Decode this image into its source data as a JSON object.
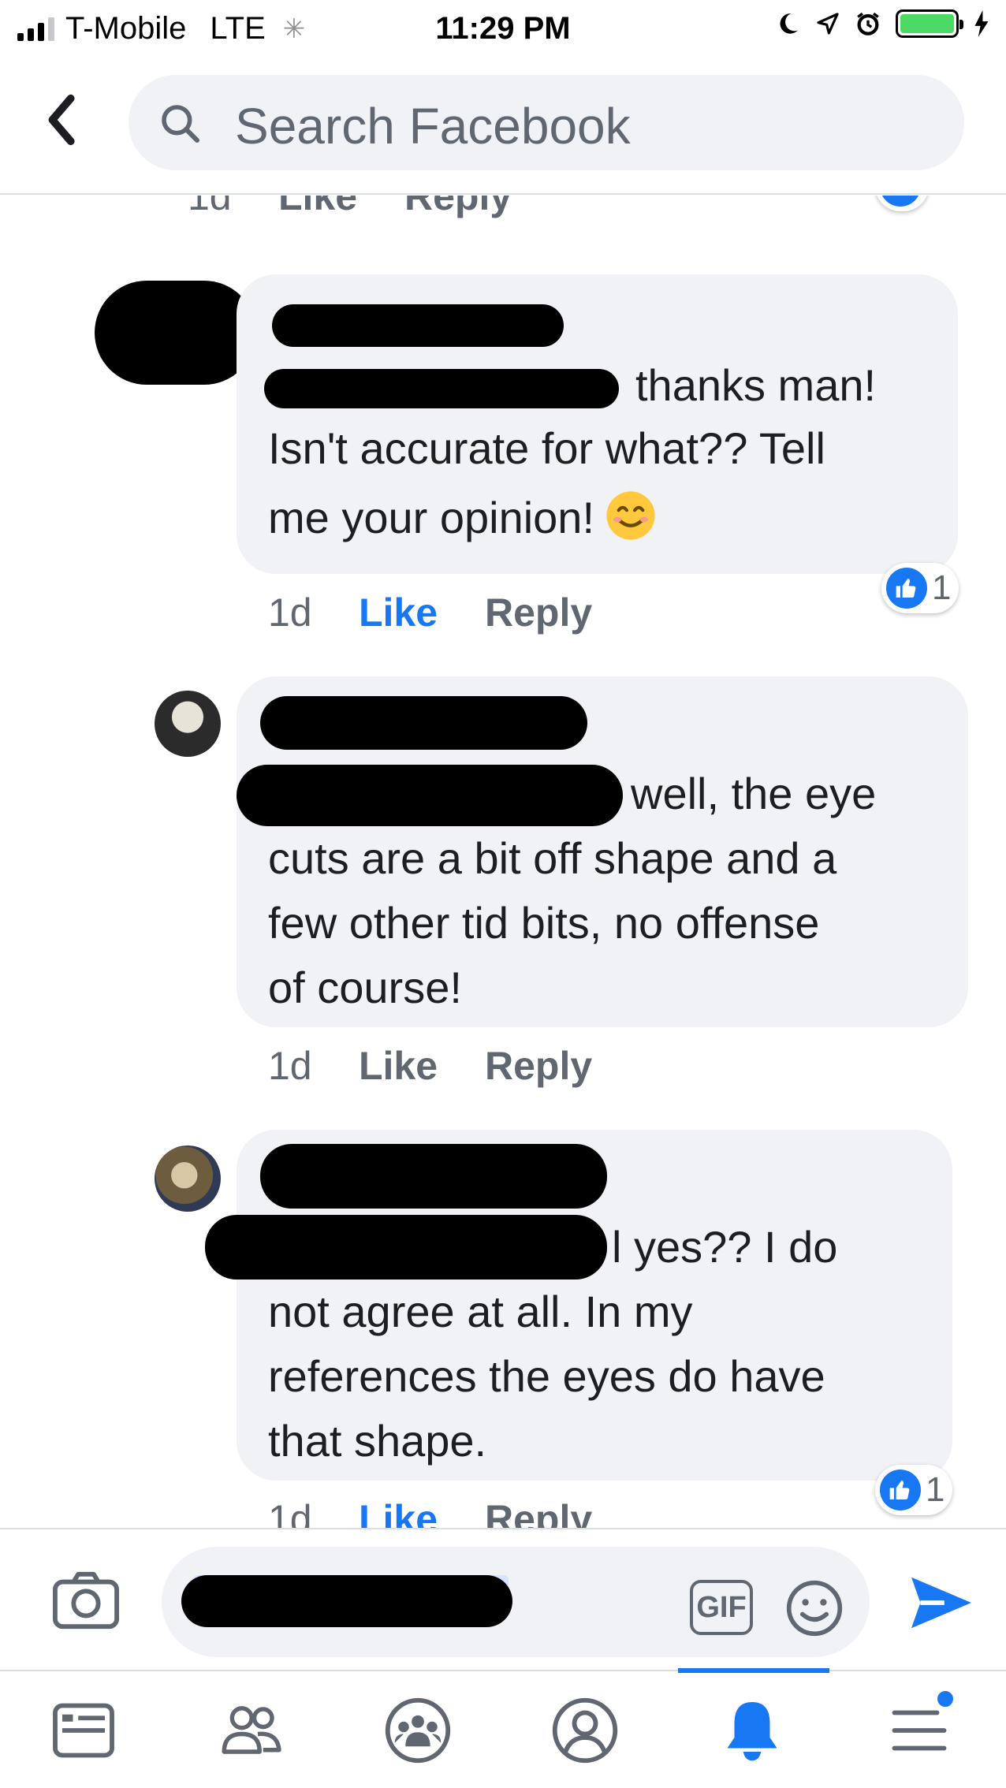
{
  "status_bar": {
    "carrier": "T-Mobile",
    "network": "LTE",
    "time": "11:29 PM"
  },
  "search": {
    "placeholder": "Search Facebook"
  },
  "comments": [
    {
      "text_lines": [
        "thanks man!",
        "Isn't accurate for what?? Tell",
        "me your opinion!"
      ],
      "emoji": "smiling-face-emoji",
      "time": "1d",
      "like_label": "Like",
      "reply_label": "Reply",
      "reaction_count": "1",
      "liked": true
    },
    {
      "text_lines": [
        "well, the eye",
        "cuts are a bit off shape and a",
        "few other tid bits, no offense",
        "of course!"
      ],
      "time": "1d",
      "like_label": "Like",
      "reply_label": "Reply",
      "liked": false
    },
    {
      "text_lines": [
        "l yes?? I do",
        "not agree at all. In my",
        "references the eyes do have",
        "that shape."
      ],
      "time": "1d",
      "like_label": "Like",
      "reply_label": "Reply",
      "reaction_count": "1",
      "liked": true
    }
  ],
  "top_cutoff": {
    "time": "1d",
    "like_label": "Like",
    "reply_label": "Reply"
  },
  "composer": {
    "gif_label": "GIF"
  },
  "tabs": [
    "news-feed",
    "friends",
    "groups",
    "profile",
    "notifications",
    "menu"
  ],
  "colors": {
    "accent": "#1877f2",
    "bubble": "#f0f2f5",
    "muted": "#606770"
  }
}
